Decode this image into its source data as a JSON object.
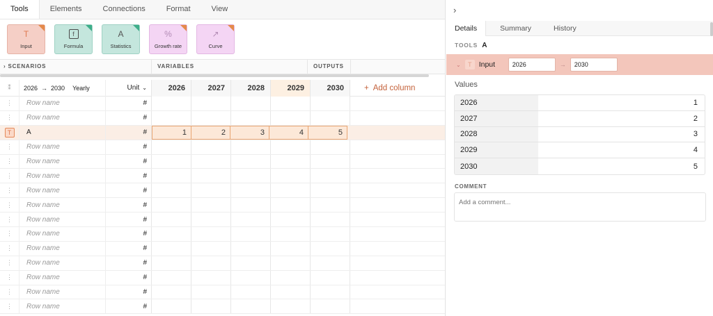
{
  "top_tabs": [
    "Tools",
    "Elements",
    "Connections",
    "Format",
    "View"
  ],
  "tools": [
    {
      "label": "Input",
      "icon": "text-t-icon",
      "glyph": "T"
    },
    {
      "label": "Formula",
      "icon": "formula-icon",
      "glyph": "f"
    },
    {
      "label": "Statistics",
      "icon": "statistics-icon",
      "glyph": "A"
    },
    {
      "label": "Growth rate",
      "icon": "percent-icon",
      "glyph": "%"
    },
    {
      "label": "Curve",
      "icon": "curve-chart-icon",
      "glyph": "↗"
    }
  ],
  "sections": {
    "scenarios": "SCENARIOS",
    "variables": "VARIABLES",
    "outputs": "OUTPUTS"
  },
  "grid": {
    "year_from": "2026",
    "year_to": "2030",
    "period": "Yearly",
    "unit_label": "Unit",
    "years": [
      "2026",
      "2027",
      "2028",
      "2029",
      "2030"
    ],
    "add_column": "Add column",
    "rows": [
      {
        "name": "Row name",
        "unit": "#",
        "values": [
          "",
          "",
          "",
          "",
          ""
        ],
        "selected": false
      },
      {
        "name": "Row name",
        "unit": "#",
        "values": [
          "",
          "",
          "",
          "",
          ""
        ],
        "selected": false
      },
      {
        "name": "A",
        "unit": "#",
        "values": [
          "1",
          "2",
          "3",
          "4",
          "5"
        ],
        "selected": true
      },
      {
        "name": "Row name",
        "unit": "#",
        "values": [
          "",
          "",
          "",
          "",
          ""
        ],
        "selected": false
      },
      {
        "name": "Row name",
        "unit": "#",
        "values": [
          "",
          "",
          "",
          "",
          ""
        ],
        "selected": false
      },
      {
        "name": "Row name",
        "unit": "#",
        "values": [
          "",
          "",
          "",
          "",
          ""
        ],
        "selected": false
      },
      {
        "name": "Row name",
        "unit": "#",
        "values": [
          "",
          "",
          "",
          "",
          ""
        ],
        "selected": false
      },
      {
        "name": "Row name",
        "unit": "#",
        "values": [
          "",
          "",
          "",
          "",
          ""
        ],
        "selected": false
      },
      {
        "name": "Row name",
        "unit": "#",
        "values": [
          "",
          "",
          "",
          "",
          ""
        ],
        "selected": false
      },
      {
        "name": "Row name",
        "unit": "#",
        "values": [
          "",
          "",
          "",
          "",
          ""
        ],
        "selected": false
      },
      {
        "name": "Row name",
        "unit": "#",
        "values": [
          "",
          "",
          "",
          "",
          ""
        ],
        "selected": false
      },
      {
        "name": "Row name",
        "unit": "#",
        "values": [
          "",
          "",
          "",
          "",
          ""
        ],
        "selected": false
      },
      {
        "name": "Row name",
        "unit": "#",
        "values": [
          "",
          "",
          "",
          "",
          ""
        ],
        "selected": false
      },
      {
        "name": "Row name",
        "unit": "#",
        "values": [
          "",
          "",
          "",
          "",
          ""
        ],
        "selected": false
      },
      {
        "name": "Row name",
        "unit": "#",
        "values": [
          "",
          "",
          "",
          "",
          ""
        ],
        "selected": false
      }
    ]
  },
  "panel": {
    "tabs": [
      "Details",
      "Summary",
      "History"
    ],
    "crumb_label": "TOOLS",
    "crumb_name": "A",
    "input_title": "Input",
    "from": "2026",
    "to": "2030",
    "values_label": "Values",
    "values": [
      {
        "year": "2026",
        "value": "1"
      },
      {
        "year": "2027",
        "value": "2"
      },
      {
        "year": "2028",
        "value": "3"
      },
      {
        "year": "2029",
        "value": "4"
      },
      {
        "year": "2030",
        "value": "5"
      }
    ],
    "comment_label": "COMMENT",
    "comment_placeholder": "Add a comment..."
  },
  "colors": {
    "accent": "#e07b52",
    "selected_row": "#fbeee5",
    "panel_header": "#f3c6bb"
  }
}
